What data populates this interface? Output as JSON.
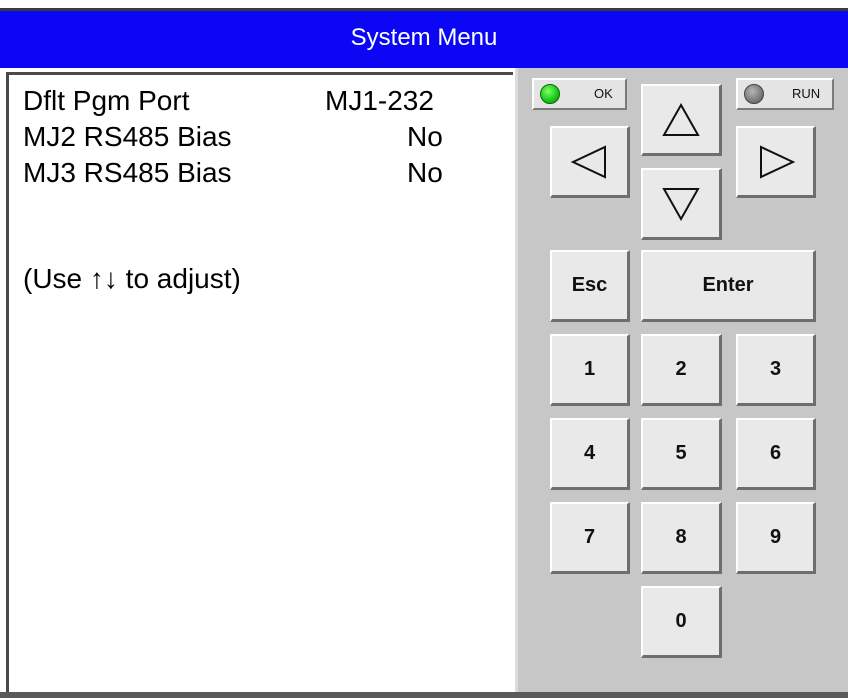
{
  "window": {
    "title": "System Menu"
  },
  "screen": {
    "rows": [
      {
        "label": "Dflt Pgm Port",
        "value": "MJ1-232"
      },
      {
        "label": "MJ2 RS485 Bias",
        "value": "No"
      },
      {
        "label": "MJ3 RS485 Bias",
        "value": "No"
      }
    ],
    "hint": "(Use ↑↓ to adjust)"
  },
  "indicators": {
    "ok": {
      "label": "OK",
      "color": "#14c514",
      "state": "on"
    },
    "run": {
      "label": "RUN",
      "color": "#7a7a7a",
      "state": "off"
    }
  },
  "keypad": {
    "up_icon": "up-triangle-icon",
    "down_icon": "down-triangle-icon",
    "left_icon": "left-triangle-icon",
    "right_icon": "right-triangle-icon",
    "esc_label": "Esc",
    "enter_label": "Enter",
    "digits": [
      "1",
      "2",
      "3",
      "4",
      "5",
      "6",
      "7",
      "8",
      "9",
      "0"
    ]
  },
  "colors": {
    "title_bar": "#0b07f5",
    "keypad_bg": "#c7c7c7",
    "key_face": "#e9e9e9"
  }
}
